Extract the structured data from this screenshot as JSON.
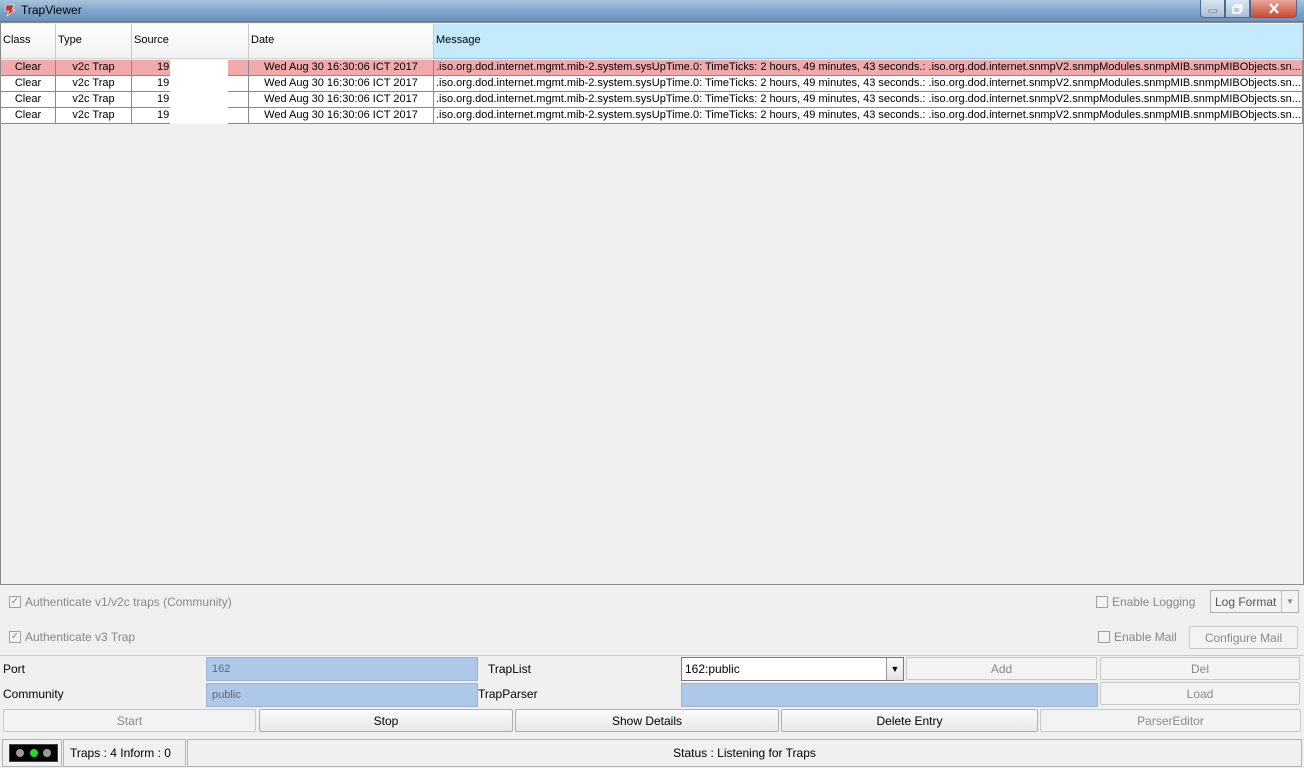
{
  "window": {
    "title": "TrapViewer"
  },
  "table": {
    "columns": [
      "Class",
      "Type",
      "Source",
      "Date",
      "Message"
    ],
    "rows": [
      {
        "class": "Clear",
        "type": "v2c Trap",
        "source": "19",
        "date": "Wed Aug 30 16:30:06 ICT 2017",
        "message": ".iso.org.dod.internet.mgmt.mib-2.system.sysUpTime.0:  TimeTicks:  2 hours, 49 minutes, 43 seconds.: .iso.org.dod.internet.snmpV2.snmpModules.snmpMIB.snmpMIBObjects.sn..."
      },
      {
        "class": "Clear",
        "type": "v2c Trap",
        "source": "19",
        "date": "Wed Aug 30 16:30:06 ICT 2017",
        "message": ".iso.org.dod.internet.mgmt.mib-2.system.sysUpTime.0:  TimeTicks:  2 hours, 49 minutes, 43 seconds.: .iso.org.dod.internet.snmpV2.snmpModules.snmpMIB.snmpMIBObjects.sn..."
      },
      {
        "class": "Clear",
        "type": "v2c Trap",
        "source": "19",
        "date": "Wed Aug 30 16:30:06 ICT 2017",
        "message": ".iso.org.dod.internet.mgmt.mib-2.system.sysUpTime.0:  TimeTicks:  2 hours, 49 minutes, 43 seconds.: .iso.org.dod.internet.snmpV2.snmpModules.snmpMIB.snmpMIBObjects.sn..."
      },
      {
        "class": "Clear",
        "type": "v2c Trap",
        "source": "19",
        "date": "Wed Aug 30 16:30:06 ICT 2017",
        "message": ".iso.org.dod.internet.mgmt.mib-2.system.sysUpTime.0:  TimeTicks:  2 hours, 49 minutes, 43 seconds.: .iso.org.dod.internet.snmpV2.snmpModules.snmpMIB.snmpMIBObjects.sn..."
      }
    ],
    "selected_row_color": "#f2a9ab"
  },
  "options": {
    "auth_v1v2c": "Authenticate v1/v2c traps (Community)",
    "auth_v3": "Authenticate v3 Trap",
    "enable_logging": "Enable Logging",
    "log_format": "Log Format",
    "enable_mail": "Enable Mail",
    "configure_mail": "Configure Mail"
  },
  "settings": {
    "port_label": "Port",
    "port_value": "162",
    "community_label": "Community",
    "community_value": "public",
    "traplist_label": "TrapList",
    "traplist_value": "162:public",
    "trapparser_label": "TrapParser",
    "add_label": "Add",
    "del_label": "Del",
    "load_label": "Load"
  },
  "actions": {
    "start": "Start",
    "stop": "Stop",
    "show_details": "Show Details",
    "delete_entry": "Delete Entry",
    "parser_editor": "ParserEditor"
  },
  "status": {
    "traps": "Traps :  4 Inform :  0",
    "message": "Status : Listening for Traps",
    "light_colors": [
      "#9a9a9a",
      "#22dd22",
      "#9a9a9a"
    ]
  },
  "colors": {
    "field_bg": "#adc8e8",
    "header_active": "#c3eafd"
  }
}
